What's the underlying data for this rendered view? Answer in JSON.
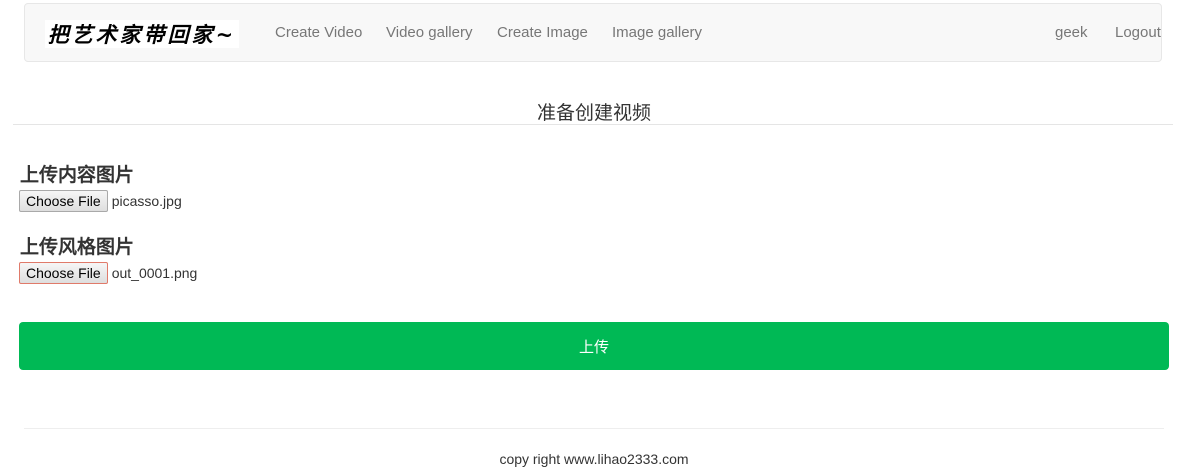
{
  "navbar": {
    "brand": "把艺术家带回家~",
    "links": [
      {
        "label": "Create Video"
      },
      {
        "label": "Video gallery"
      },
      {
        "label": "Create Image"
      },
      {
        "label": "Image gallery"
      }
    ],
    "user": "geek",
    "logout": "Logout"
  },
  "page": {
    "title": "准备创建视频"
  },
  "form": {
    "content_label": "上传内容图片",
    "content_button": "Choose File",
    "content_file": "picasso.jpg",
    "style_label": "上传风格图片",
    "style_button": "Choose File",
    "style_file": "out_0001.png",
    "submit_label": "上传"
  },
  "footer": {
    "text": "copy right www.lihao2333.com"
  },
  "colors": {
    "accent": "#00b955",
    "navbar_bg": "#f8f8f8",
    "nav_text": "#777777"
  }
}
